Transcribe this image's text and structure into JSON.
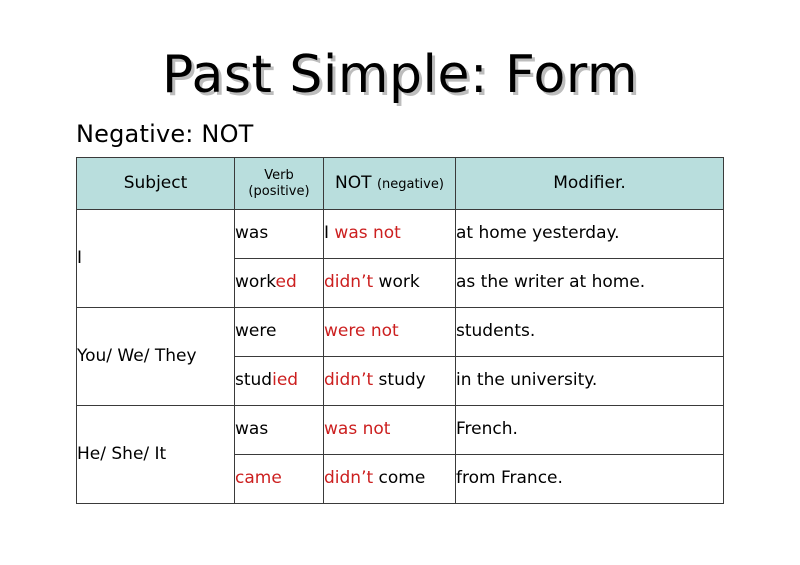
{
  "slide": {
    "title": "Past Simple: Form",
    "subtitle": "Negative: NOT",
    "accent_color": "#b9dedd",
    "red_color": "#cc1f1f",
    "text_color": "#000000",
    "border_color": "#3a3a3a",
    "background": "#ffffff"
  },
  "table": {
    "headers": {
      "subject": "Subject",
      "verb_line1": "Verb",
      "verb_line2": "(positive)",
      "not_main": "NOT",
      "not_sub": "(negative)",
      "modifier": "Modifier."
    },
    "groups": [
      {
        "subject": "I",
        "rows": [
          {
            "verb_black": "was",
            "verb_red": "",
            "not_black_prefix": "I ",
            "not_red": "was not",
            "not_black_suffix": "",
            "modifier": "at home yesterday."
          },
          {
            "verb_black": "work",
            "verb_red": "ed",
            "not_black_prefix": "",
            "not_red": "didn’t",
            "not_black_suffix": " work",
            "modifier": "as the writer at home."
          }
        ]
      },
      {
        "subject": "You/ We/ They",
        "rows": [
          {
            "verb_black": "were",
            "verb_red": "",
            "not_black_prefix": "",
            "not_red": "were not",
            "not_black_suffix": "",
            "modifier": "students."
          },
          {
            "verb_black": "stud",
            "verb_red": "ied",
            "not_black_prefix": "",
            "not_red": "didn’t",
            "not_black_suffix": " study",
            "modifier": "in the university."
          }
        ]
      },
      {
        "subject": "He/ She/ It",
        "rows": [
          {
            "verb_black": "was",
            "verb_red": "",
            "not_black_prefix": "",
            "not_red": "was not",
            "not_black_suffix": "",
            "modifier": "French."
          },
          {
            "verb_black": "",
            "verb_red": "came",
            "not_black_prefix": "",
            "not_red": "didn’t",
            "not_black_suffix": " come",
            "modifier": "from France."
          }
        ]
      }
    ]
  }
}
